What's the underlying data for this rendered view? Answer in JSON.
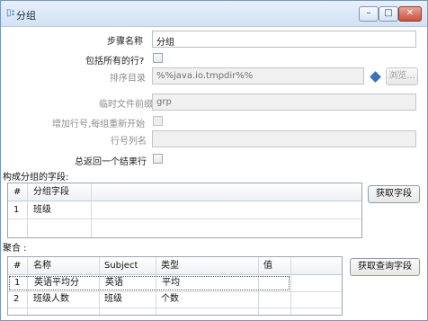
{
  "window": {
    "title": "分组",
    "icon": "step-icon"
  },
  "form": {
    "step_name_label": "步骤名称",
    "step_name_value": "分组",
    "include_all_rows_label": "包括所有的行?",
    "sort_dir_label": "排序目录",
    "sort_dir_value": "%%java.io.tmpdir%%",
    "browse_label": "浏览...",
    "temp_prefix_label": "临时文件前缀",
    "temp_prefix_value": "grp",
    "add_linenr_label": "增加行号,每组重新开始",
    "linenr_field_label": "行号列名",
    "always_one_row_label": "总返回一个结果行"
  },
  "group_section": {
    "title": "构成分组的字段:",
    "columns": [
      "#",
      "分组字段"
    ],
    "rows": [
      {
        "num": "1",
        "field": "班级"
      }
    ],
    "get_fields_label": "获取字段"
  },
  "agg_section": {
    "title": "聚合 :",
    "columns": [
      "#",
      "名称",
      "Subject",
      "类型",
      "值"
    ],
    "rows": [
      {
        "num": "1",
        "name": "英语平均分",
        "subject": "英语",
        "type": "平均",
        "value": ""
      },
      {
        "num": "2",
        "name": "班级人数",
        "subject": "班级",
        "type": "个数",
        "value": ""
      }
    ],
    "get_lookup_fields_label": "获取查询字段"
  }
}
